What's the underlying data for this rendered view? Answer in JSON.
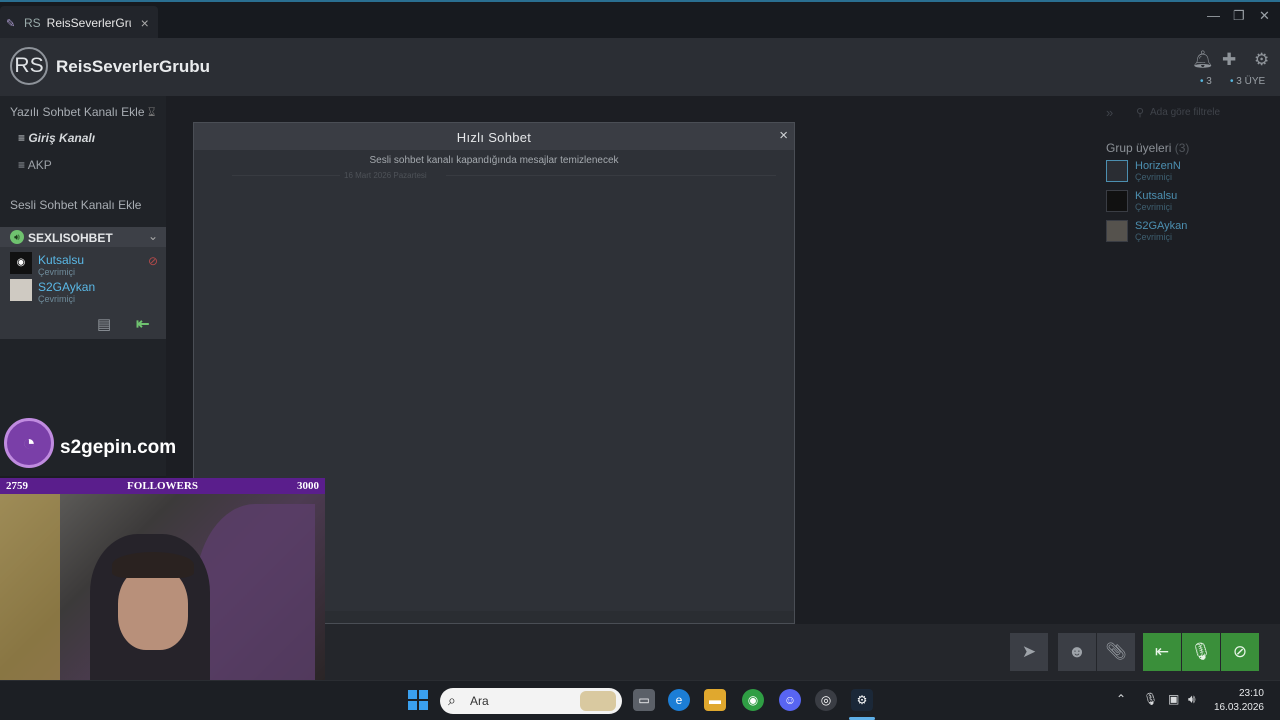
{
  "window": {
    "tab_avatar": "RS",
    "tab_title": "ReisSeverlerGrubu",
    "tab_close": "×",
    "minimize": "—",
    "maximize": "❐",
    "close": "✕"
  },
  "group": {
    "avatar": "RS",
    "name": "ReisSeverlerGrubu",
    "online_count": "3",
    "member_count": "3 ÜYE"
  },
  "sidebar": {
    "text_channels_label": "Yazılı Sohbet Kanalı Ekle",
    "text_channels": [
      "Giriş Kanalı",
      "AKP"
    ],
    "voice_channels_label": "Sesli Sohbet Kanalı Ekle",
    "voice_channel": {
      "name": "SEXLISOHBET",
      "users": [
        {
          "name": "Kutsalsu",
          "status": "Çevrimiçi"
        },
        {
          "name": "S2GAykan",
          "status": "Çevrimiçi"
        }
      ]
    }
  },
  "modal": {
    "title": "Hızlı Sohbet",
    "close": "×",
    "note": "Sesli sohbet kanalı kapandığında mesajlar temizlenecek",
    "date": "16 Mart 2026 Pazartesi"
  },
  "members": {
    "search_placeholder": "Ada göre filtrele",
    "title": "Grup üyeleri",
    "count": "(3)",
    "list": [
      {
        "name": "HorizenN",
        "status": "Çevrimiçi"
      },
      {
        "name": "Kutsalsu",
        "status": "Çevrimiçi"
      },
      {
        "name": "S2GAykan",
        "status": "Çevrimiçi"
      }
    ]
  },
  "overlay": {
    "brand": "s2gepin.com",
    "followers_current": "2759",
    "followers_label": "FOLLOWERS",
    "followers_goal": "3000"
  },
  "taskbar": {
    "search_label": "Ara",
    "time": "23:10",
    "date": "16.03.2026"
  },
  "colors": {
    "accent": "#57b8e0",
    "voice_green": "#3a8f3a",
    "overlay_purple": "#5a1e8c"
  }
}
